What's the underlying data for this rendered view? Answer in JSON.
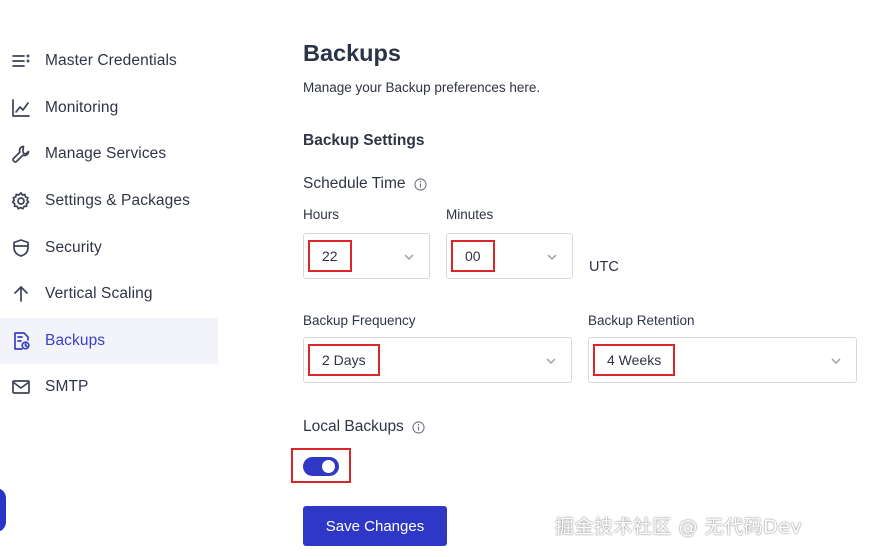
{
  "sidebar": {
    "items": [
      {
        "label": "Master Credentials",
        "icon": "list-icon"
      },
      {
        "label": "Monitoring",
        "icon": "chart-line-icon"
      },
      {
        "label": "Manage Services",
        "icon": "wrench-icon"
      },
      {
        "label": "Settings & Packages",
        "icon": "gear-icon"
      },
      {
        "label": "Security",
        "icon": "shield-icon"
      },
      {
        "label": "Vertical Scaling",
        "icon": "arrow-up-icon"
      },
      {
        "label": "Backups",
        "icon": "backup-file-icon",
        "active": true
      },
      {
        "label": "SMTP",
        "icon": "mail-icon"
      }
    ]
  },
  "main": {
    "title": "Backups",
    "description": "Manage your Backup preferences here.",
    "section_title": "Backup Settings",
    "schedule_time_label": "Schedule Time",
    "hours_label": "Hours",
    "hours_value": "22",
    "minutes_label": "Minutes",
    "minutes_value": "00",
    "timezone": "UTC",
    "frequency_label": "Backup Frequency",
    "frequency_value": "2 Days",
    "retention_label": "Backup Retention",
    "retention_value": "4 Weeks",
    "local_backups_label": "Local Backups",
    "local_backups_enabled": true,
    "save_label": "Save Changes"
  },
  "watermark": "掘金技术社区 @ 无代码Dev",
  "colors": {
    "accent": "#2f38c6",
    "active_bg": "#f3f4fa",
    "highlight_border": "#d8262b"
  }
}
